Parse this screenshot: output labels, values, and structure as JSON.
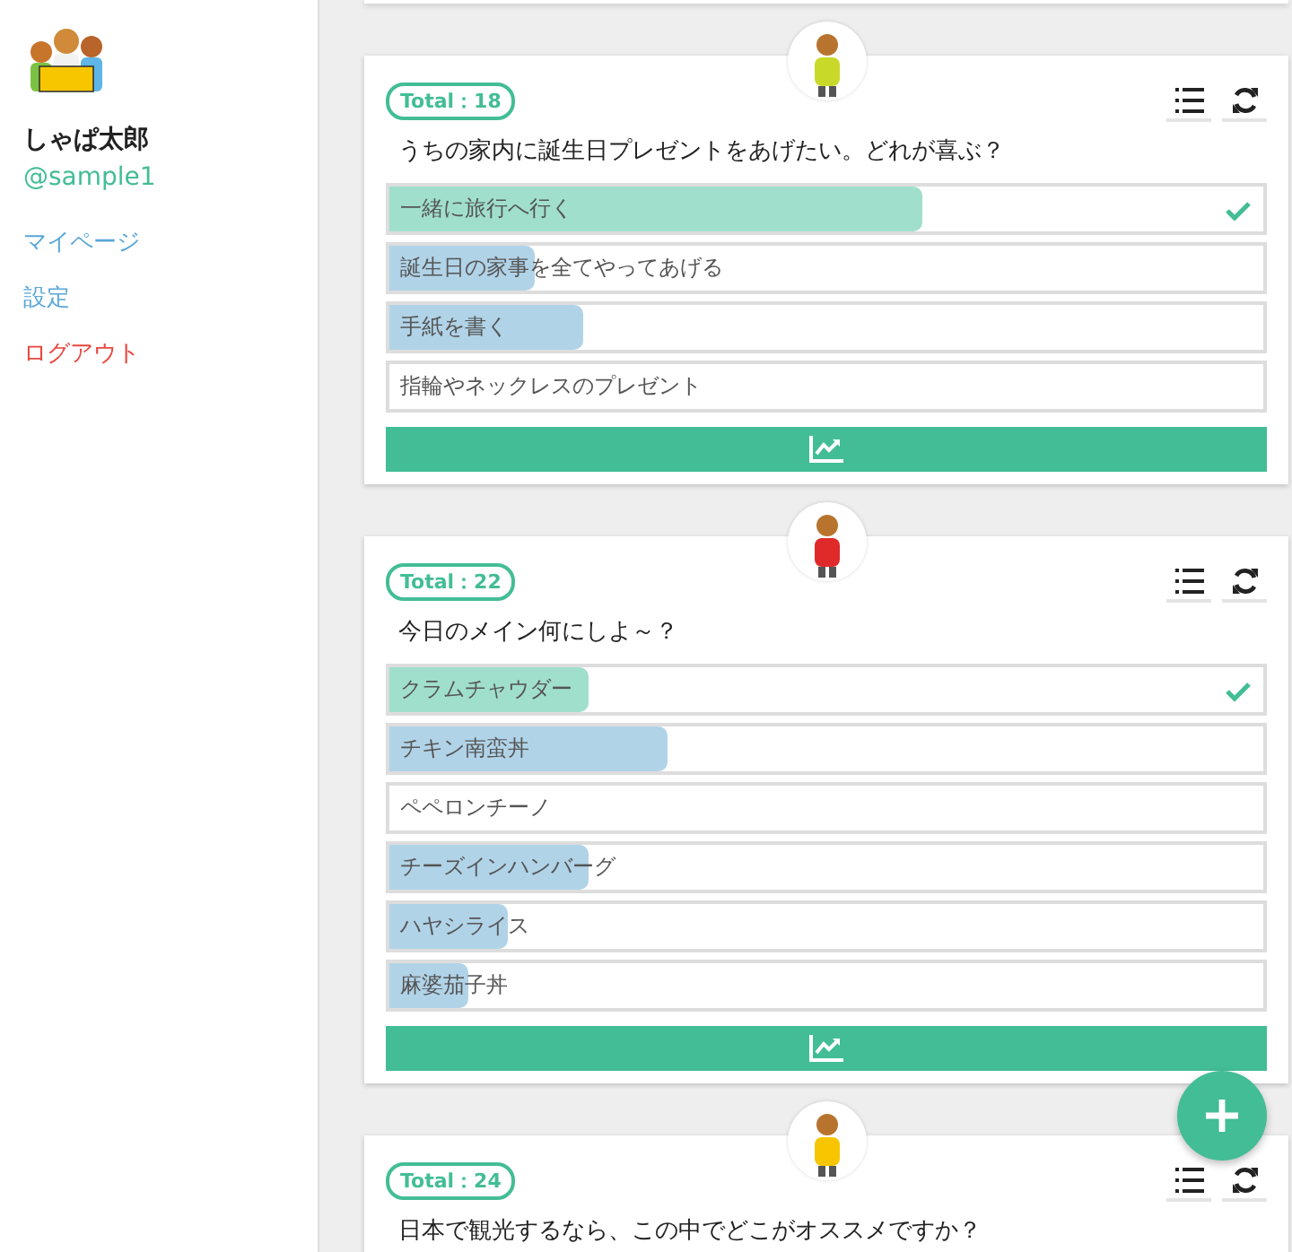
{
  "sidebar": {
    "user_name": "しゃぱ太郎",
    "handle": "@sample1",
    "links": [
      {
        "label": "マイページ",
        "kind": "nav"
      },
      {
        "label": "設定",
        "kind": "nav"
      },
      {
        "label": "ログアウト",
        "kind": "logout"
      }
    ]
  },
  "polls": [
    {
      "total": "Total：18",
      "question": "うちの家内に誕生日プレゼントをあげたい。どれが喜ぶ？",
      "options": [
        {
          "label": "一緒に旅行へ行く",
          "level": 0.61,
          "selected": true
        },
        {
          "label": "誕生日の家事を全てやってあげる",
          "level": 0.167,
          "selected": false
        },
        {
          "label": "手紙を書く",
          "level": 0.222,
          "selected": false
        },
        {
          "label": "指輪やネックレスのプレゼント",
          "selected": false
        }
      ]
    },
    {
      "total": "Total：22",
      "question": "今日のメイン何にしよ～？",
      "options": [
        {
          "label": "クラムチャウダー",
          "level": 0.227,
          "selected": true
        },
        {
          "label": "チキン南蛮丼",
          "level": 0.318,
          "selected": false
        },
        {
          "label": "ペペロンチーノ",
          "selected": false
        },
        {
          "label": "チーズインハンバーグ",
          "level": 0.227,
          "selected": false
        },
        {
          "label": "ハヤシライス",
          "level": 0.136,
          "selected": false
        },
        {
          "label": "麻婆茄子丼",
          "level": 0.091,
          "selected": false
        }
      ]
    },
    {
      "total": "Total：24",
      "question": "日本で観光するなら、この中でどこがオススメですか？"
    }
  ]
}
